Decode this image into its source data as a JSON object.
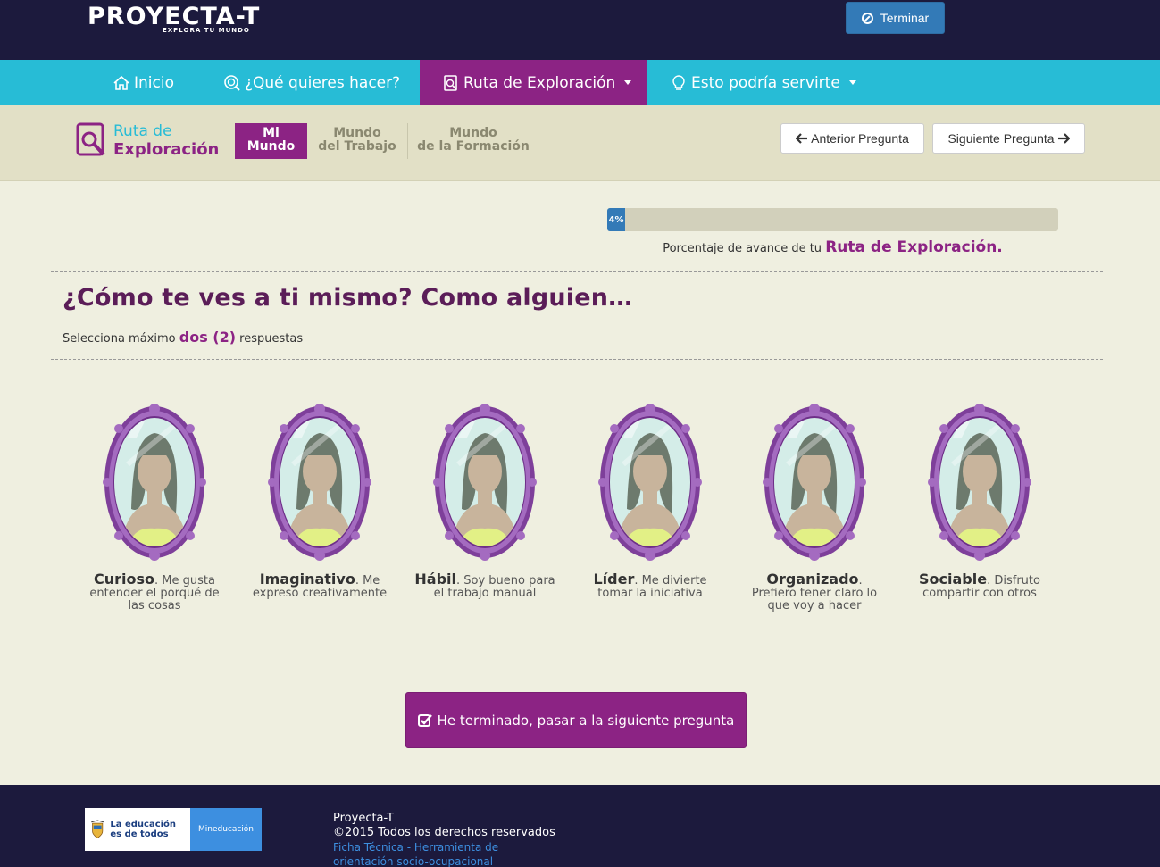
{
  "header": {
    "logo_text": "PROYECTA-T",
    "logo_tagline": "EXPLORA TU MUNDO",
    "terminar_label": "Terminar"
  },
  "nav": {
    "items": [
      {
        "label": "Inicio",
        "icon": "home-icon"
      },
      {
        "label": "¿Qué quieres hacer?",
        "icon": "search-icon"
      },
      {
        "label": "Ruta de Exploración",
        "icon": "search-doc-icon",
        "active": true,
        "dropdown": true
      },
      {
        "label": "Esto podría servirte",
        "icon": "lightbulb-icon",
        "dropdown": true
      }
    ]
  },
  "subnav": {
    "ruta_line1": "Ruta de",
    "ruta_line2": "Exploración",
    "tabs": [
      {
        "line1": "Mi",
        "line2": "Mundo",
        "active": true
      },
      {
        "line1": "Mundo",
        "line2": "del Trabajo"
      },
      {
        "line1": "Mundo",
        "line2": "de la Formación"
      }
    ],
    "prev_label": "Anterior Pregunta",
    "next_label": "Siguiente Pregunta"
  },
  "progress": {
    "percent": 4,
    "label": "4%",
    "caption_prefix": "Porcentaje de avance de tu ",
    "caption_highlight": "Ruta de Exploración."
  },
  "question": {
    "title": "¿Cómo te ves a ti mismo? Como alguien…",
    "instruction_prefix": "Selecciona máximo ",
    "instruction_highlight": "dos (2)",
    "instruction_suffix": " respuestas"
  },
  "options": [
    {
      "title": "Curioso",
      "desc": ". Me gusta entender el porqué de las cosas"
    },
    {
      "title": "Imaginativo",
      "desc": ". Me expreso creativamente"
    },
    {
      "title": "Hábil",
      "desc": ". Soy bueno para el trabajo manual"
    },
    {
      "title": "Líder",
      "desc": ". Me divierte tomar la iniciativa"
    },
    {
      "title": "Organizado",
      "desc": ". Prefiero tener claro lo que voy a hacer"
    },
    {
      "title": "Sociable",
      "desc": ". Disfruto compartir con otros"
    }
  ],
  "submit_label": "He terminado, pasar a la siguiente pregunta",
  "footer": {
    "logo_left": "La educación es de todos",
    "logo_right": "Mineducación",
    "name": "Proyecta-T",
    "copyright": "©2015 Todos los derechos reservados",
    "link1": "Ficha Técnica - Herramienta de",
    "link2": "orientación socio-ocupacional"
  },
  "colors": {
    "primary": "#8c2384",
    "nav": "#27bcd6",
    "dark": "#1c1a3d",
    "button_blue": "#337ab7"
  }
}
